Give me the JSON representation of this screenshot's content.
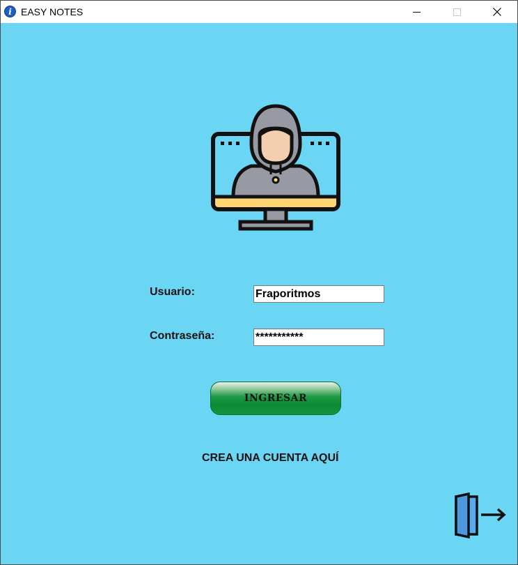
{
  "window": {
    "title": "EASY NOTES",
    "icon": "info-icon",
    "controls": [
      "minimize-icon",
      "maximize-icon",
      "close-icon"
    ]
  },
  "login": {
    "hero_icon": "hooded-user-monitor-icon",
    "username_label": "Usuario:",
    "username_value": "Fraporitmos",
    "password_label": "Contraseña:",
    "password_value": "***********",
    "submit_label": "INGRESAR",
    "create_account_label": "CREA UNA CUENTA AQUÍ",
    "exit_icon": "exit-door-icon"
  },
  "colors": {
    "background": "#6ad6f4",
    "button_green": "#0c8a35",
    "monitor_yellow": "#fdd673",
    "door_blue": "#5aaaf0"
  }
}
